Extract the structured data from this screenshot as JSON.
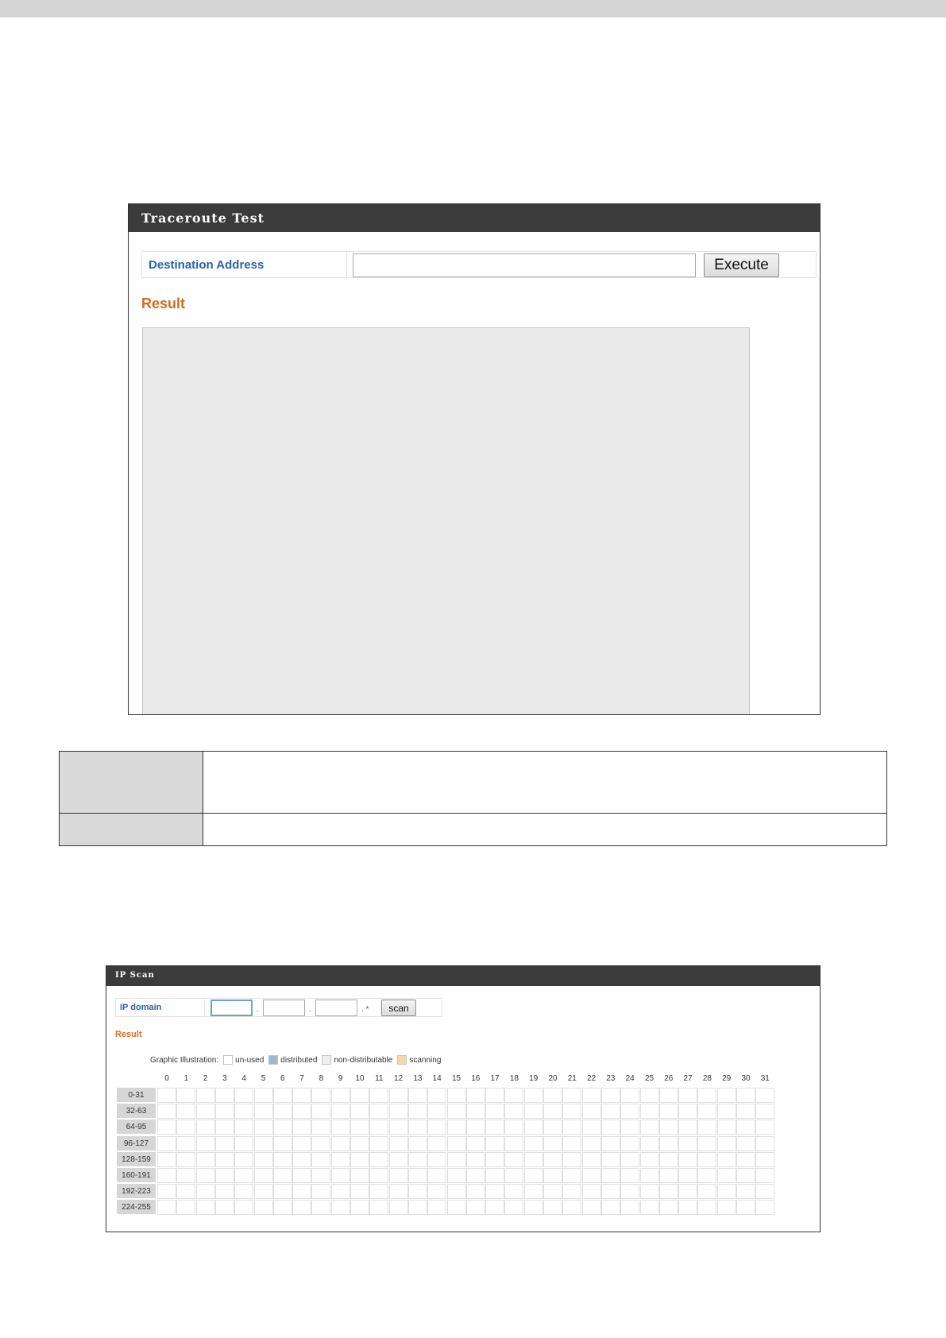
{
  "traceroute": {
    "title": "Traceroute Test",
    "destination_label": "Destination Address",
    "destination_value": "",
    "execute_label": "Execute",
    "result_label": "Result"
  },
  "ip_scan": {
    "title": "IP Scan",
    "domain_label": "IP domain",
    "octet_separator": ".",
    "wildcard": ". *",
    "scan_label": "scan",
    "result_label": "Result",
    "legend_title": "Graphic Illustration:",
    "legend": [
      {
        "label": "un-used",
        "color": "#ffffff"
      },
      {
        "label": "distributed",
        "color": "#9fb8cc"
      },
      {
        "label": "non-distributable",
        "color": "#eeeeee"
      },
      {
        "label": "scanning",
        "color": "#f7d8a8"
      }
    ],
    "columns": [
      "0",
      "1",
      "2",
      "3",
      "4",
      "5",
      "6",
      "7",
      "8",
      "9",
      "10",
      "11",
      "12",
      "13",
      "14",
      "15",
      "16",
      "17",
      "18",
      "19",
      "20",
      "21",
      "22",
      "23",
      "24",
      "25",
      "26",
      "27",
      "28",
      "29",
      "30",
      "31"
    ],
    "rows": [
      "0-31",
      "32-63",
      "64-95",
      "96-127",
      "128-159",
      "160-191",
      "192-223",
      "224-255"
    ]
  },
  "colors": {
    "header_bg": "#3b3b3b",
    "label_blue": "#2a62a8",
    "result_orange": "#d46a1c"
  }
}
